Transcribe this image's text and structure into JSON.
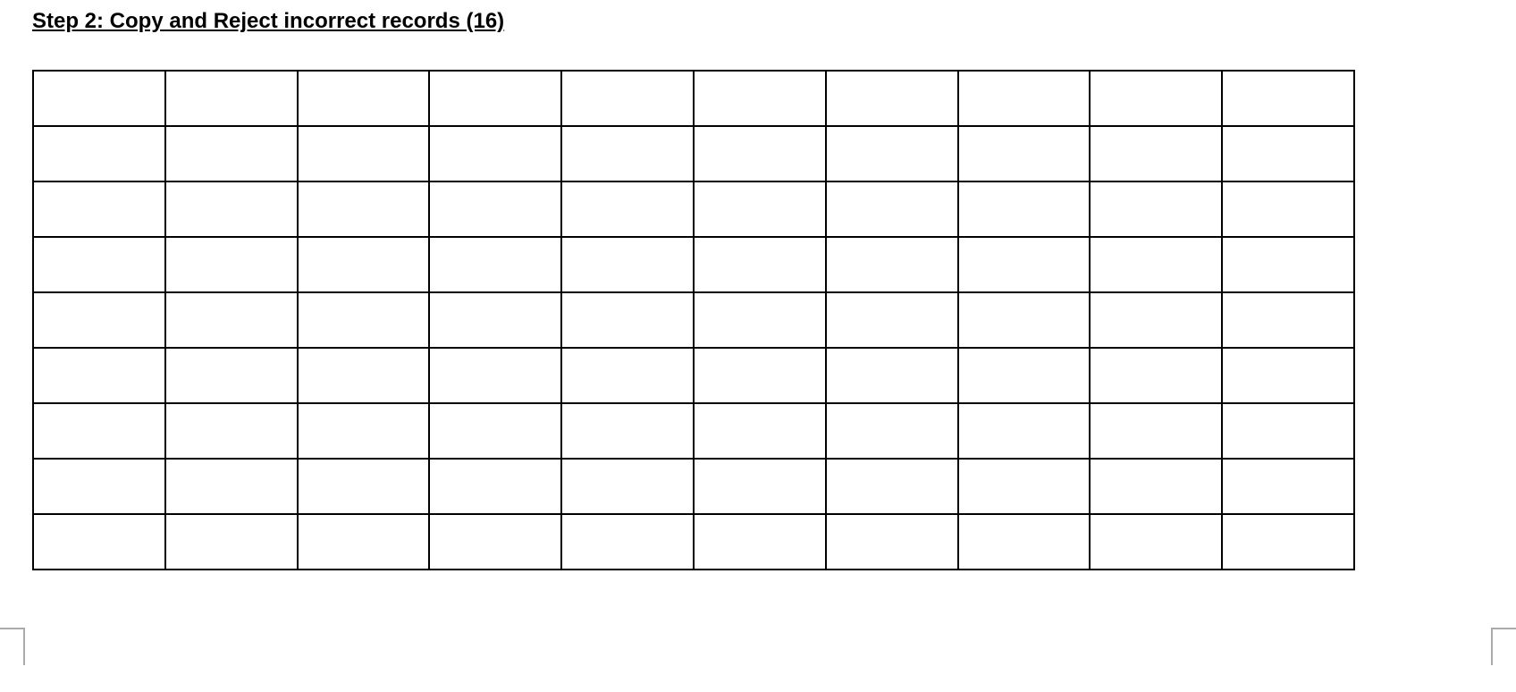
{
  "heading": "Step 2: Copy and Reject incorrect records (16)",
  "table": {
    "rows": 9,
    "cols": 10,
    "cells": [
      [
        "",
        "",
        "",
        "",
        "",
        "",
        "",
        "",
        "",
        ""
      ],
      [
        "",
        "",
        "",
        "",
        "",
        "",
        "",
        "",
        "",
        ""
      ],
      [
        "",
        "",
        "",
        "",
        "",
        "",
        "",
        "",
        "",
        ""
      ],
      [
        "",
        "",
        "",
        "",
        "",
        "",
        "",
        "",
        "",
        ""
      ],
      [
        "",
        "",
        "",
        "",
        "",
        "",
        "",
        "",
        "",
        ""
      ],
      [
        "",
        "",
        "",
        "",
        "",
        "",
        "",
        "",
        "",
        ""
      ],
      [
        "",
        "",
        "",
        "",
        "",
        "",
        "",
        "",
        "",
        ""
      ],
      [
        "",
        "",
        "",
        "",
        "",
        "",
        "",
        "",
        "",
        ""
      ],
      [
        "",
        "",
        "",
        "",
        "",
        "",
        "",
        "",
        "",
        ""
      ]
    ]
  }
}
